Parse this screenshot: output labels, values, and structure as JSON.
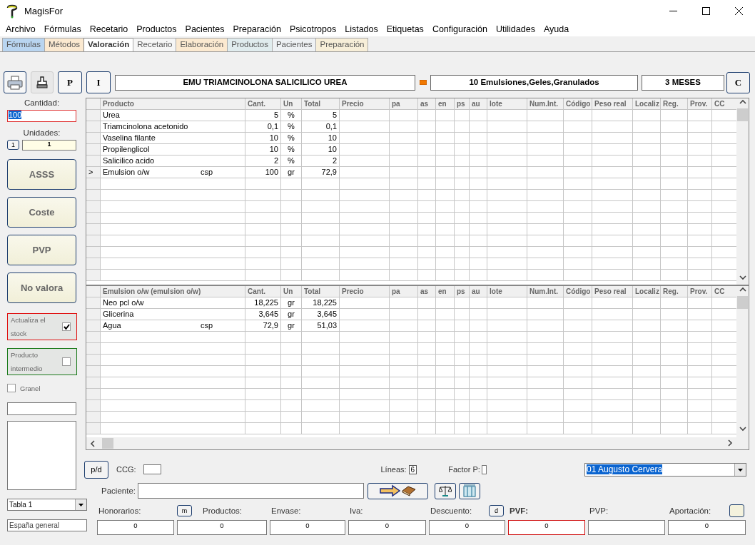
{
  "window": {
    "title": "MagisFor"
  },
  "menu": [
    "Archivo",
    "Fórmulas",
    "Recetario",
    "Productos",
    "Pacientes",
    "Preparación",
    "Psicotropos",
    "Listados",
    "Etiquetas",
    "Configuración",
    "Utilidades",
    "Ayuda"
  ],
  "tabs": [
    {
      "label": "Fórmulas",
      "selected": false,
      "color": "#b9d5f0"
    },
    {
      "label": "Métodos",
      "selected": false,
      "color": "#fbe9d0"
    },
    {
      "label": "Valoración",
      "selected": true,
      "color": "#ffffff"
    },
    {
      "label": "Recetario",
      "selected": false,
      "color": "#f6f6f6"
    },
    {
      "label": "Elaboración",
      "selected": false,
      "color": "#fbe9d0"
    },
    {
      "label": "Productos",
      "selected": false,
      "color": "#e0ecee"
    },
    {
      "label": "Pacientes",
      "selected": false,
      "color": "#eef1f4"
    },
    {
      "label": "Preparación",
      "selected": false,
      "color": "#f7eed8"
    }
  ],
  "toolbar": {
    "buttons": [
      {
        "kind": "printer"
      },
      {
        "kind": "stamp"
      },
      {
        "kind": "text",
        "label": "P"
      },
      {
        "kind": "text",
        "label": "I"
      }
    ],
    "formula_name": "EMU TRIAMCINOLONA SALICILICO UREA",
    "category": "10 Emulsiones,Geles,Granulados",
    "expiry": "3 MESES",
    "end_button": "C"
  },
  "left_panel": {
    "quantity_label": "Cantidad:",
    "quantity": "100",
    "units_label": "Unidades:",
    "units_button": "1",
    "units": "1",
    "actions": [
      "ASSS",
      "Coste",
      "PVP",
      "No valora"
    ],
    "options": [
      {
        "label": "Actualiza el stock",
        "checked": true,
        "color": "#e01010"
      },
      {
        "label": "Producto intermedio",
        "checked": false,
        "color": "#1a7a1a"
      }
    ],
    "bulk": {
      "label": "Granel",
      "checked": false
    },
    "table_select": "Tabla 1",
    "region": "España general"
  },
  "grids": [
    {
      "columns": [
        "Producto",
        "Cant.",
        "Un",
        "Total",
        "Precio",
        "pa",
        "as",
        "en",
        "ps",
        "au",
        "lote",
        "Num.Int.",
        "Código",
        "Peso real",
        "Localiz",
        "Reg.",
        "Prov.",
        "CC"
      ],
      "rows": [
        {
          "product": "Urea",
          "cant": "5",
          "un": "%",
          "total": "5"
        },
        {
          "product": "Triamcinolona acetonido",
          "cant": "0,1",
          "un": "%",
          "total": "0,1"
        },
        {
          "product": "Vaselina filante",
          "cant": "10",
          "un": "%",
          "total": "10"
        },
        {
          "product": "Propilenglicol",
          "cant": "10",
          "un": "%",
          "total": "10"
        },
        {
          "product": "Salicilico acido",
          "cant": "2",
          "un": "%",
          "total": "2"
        },
        {
          "indicator": ">",
          "product": "Emulsion o/w",
          "note": "csp",
          "cant": "100",
          "un": "gr",
          "total": "72,9"
        }
      ]
    },
    {
      "columns": [
        "Emulsion o/w (emulsion o/w)",
        "Cant.",
        "Un",
        "Total",
        "Precio",
        "pa",
        "as",
        "en",
        "ps",
        "au",
        "lote",
        "Num.Int.",
        "Código",
        "Peso real",
        "Localiz",
        "Reg.",
        "Prov.",
        "CC"
      ],
      "rows": [
        {
          "product": "Neo pcl o/w",
          "cant": "18,225",
          "un": "gr",
          "total": "18,225"
        },
        {
          "product": "Glicerina",
          "cant": "3,645",
          "un": "gr",
          "total": "3,645"
        },
        {
          "product": "Agua",
          "note": "csp",
          "cant": "72,9",
          "un": "gr",
          "total": "51,03"
        }
      ]
    }
  ],
  "bottom": {
    "pd_button": "p/d",
    "ccg_label": "CCG:",
    "lines_label": "Líneas:",
    "lines": "6",
    "factor_label": "Factor P:",
    "user": "01 Augusto Cervera",
    "patient_label": "Paciente:"
  },
  "totals": [
    {
      "label": "Honorarios:",
      "value": "0"
    },
    {
      "label": "Productos:",
      "value": "0",
      "left_button": {
        "kind": "text",
        "text": "m"
      }
    },
    {
      "label": "Envase:",
      "value": "0"
    },
    {
      "label": "Iva:",
      "value": "0"
    },
    {
      "label": "Descuento:",
      "value": "0",
      "right_button": {
        "kind": "text",
        "text": "d"
      }
    },
    {
      "label": "PVF:",
      "value": "0",
      "emphasis": true
    },
    {
      "label": "PVP:"
    },
    {
      "label": "Aportación:",
      "value": "0",
      "right_button": {
        "kind": "blank"
      }
    }
  ]
}
